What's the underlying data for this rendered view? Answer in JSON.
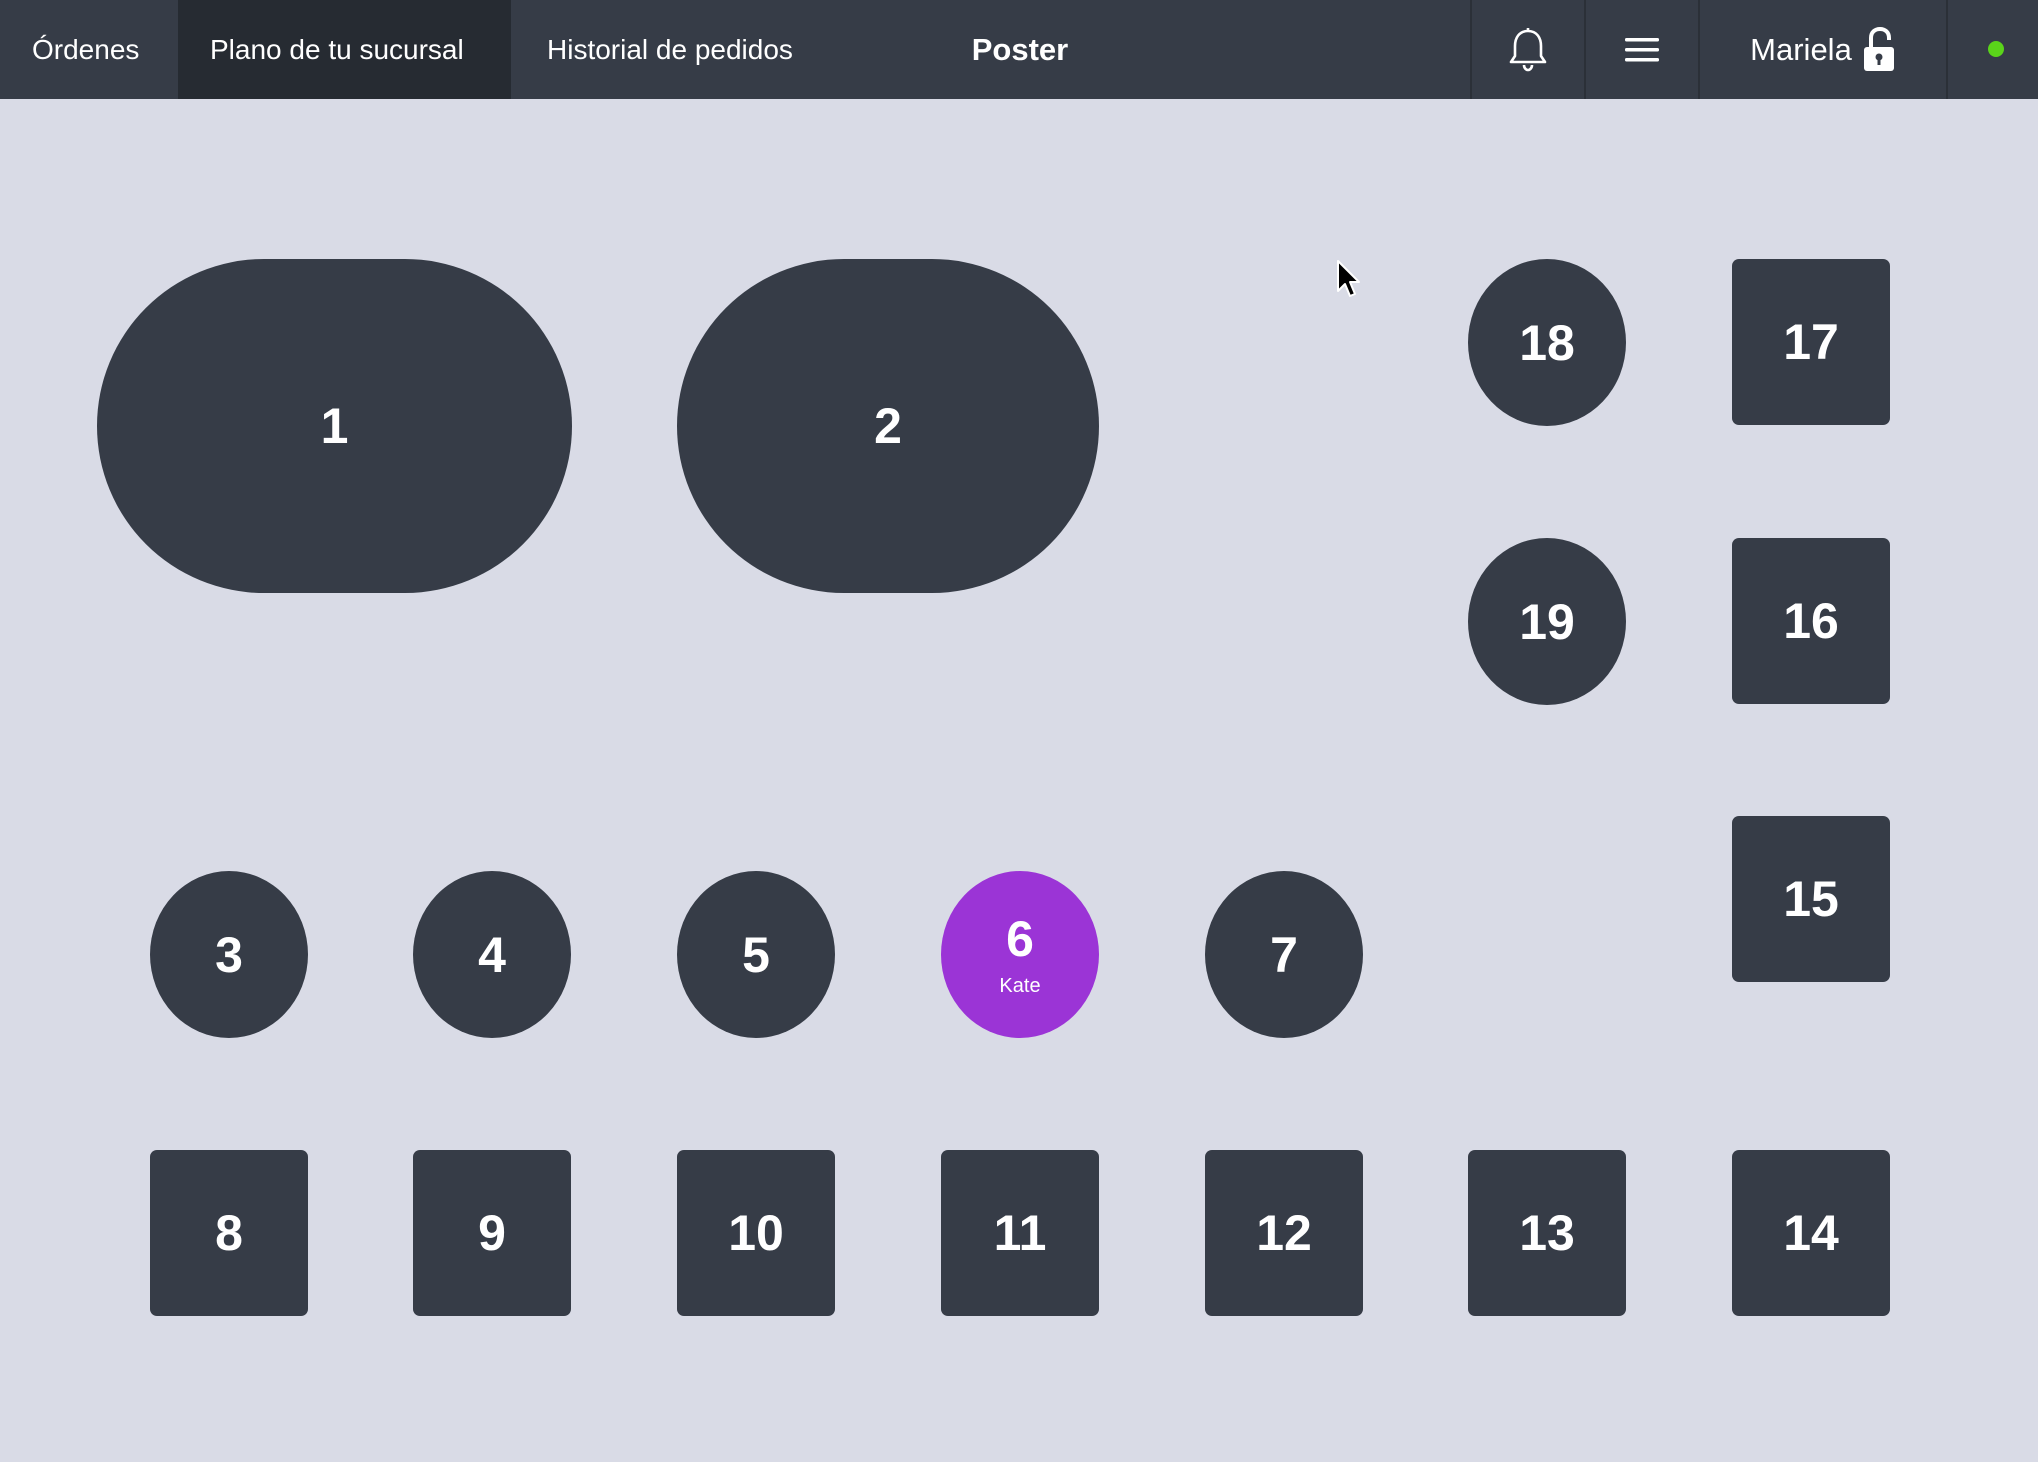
{
  "header": {
    "tabs": [
      {
        "label": "Órdenes",
        "active": false
      },
      {
        "label": "Plano de tu sucursal",
        "active": true
      },
      {
        "label": "Historial de pedidos",
        "active": false
      }
    ],
    "title": "Poster",
    "user": {
      "name": "Mariela",
      "lock_icon": "unlocked-lock-icon"
    },
    "notification_icon": "bell-icon",
    "menu_icon": "hamburger-menu-icon",
    "status_color": "#5ad41a"
  },
  "floor": {
    "background": "#d9dbe6",
    "table_color": "#363c47",
    "occupied_color": "#9b34d6",
    "tables": [
      {
        "number": "1",
        "shape": "oval",
        "guest": ""
      },
      {
        "number": "2",
        "shape": "oval",
        "guest": ""
      },
      {
        "number": "3",
        "shape": "round",
        "guest": ""
      },
      {
        "number": "4",
        "shape": "round",
        "guest": ""
      },
      {
        "number": "5",
        "shape": "round",
        "guest": ""
      },
      {
        "number": "6",
        "shape": "round",
        "guest": "Kate",
        "occupied": true
      },
      {
        "number": "7",
        "shape": "round",
        "guest": ""
      },
      {
        "number": "8",
        "shape": "square",
        "guest": ""
      },
      {
        "number": "9",
        "shape": "square",
        "guest": ""
      },
      {
        "number": "10",
        "shape": "square",
        "guest": ""
      },
      {
        "number": "11",
        "shape": "square",
        "guest": ""
      },
      {
        "number": "12",
        "shape": "square",
        "guest": ""
      },
      {
        "number": "13",
        "shape": "square",
        "guest": ""
      },
      {
        "number": "14",
        "shape": "square",
        "guest": ""
      },
      {
        "number": "15",
        "shape": "square",
        "guest": ""
      },
      {
        "number": "16",
        "shape": "square",
        "guest": ""
      },
      {
        "number": "17",
        "shape": "square",
        "guest": ""
      },
      {
        "number": "18",
        "shape": "round",
        "guest": ""
      },
      {
        "number": "19",
        "shape": "round",
        "guest": ""
      }
    ]
  }
}
